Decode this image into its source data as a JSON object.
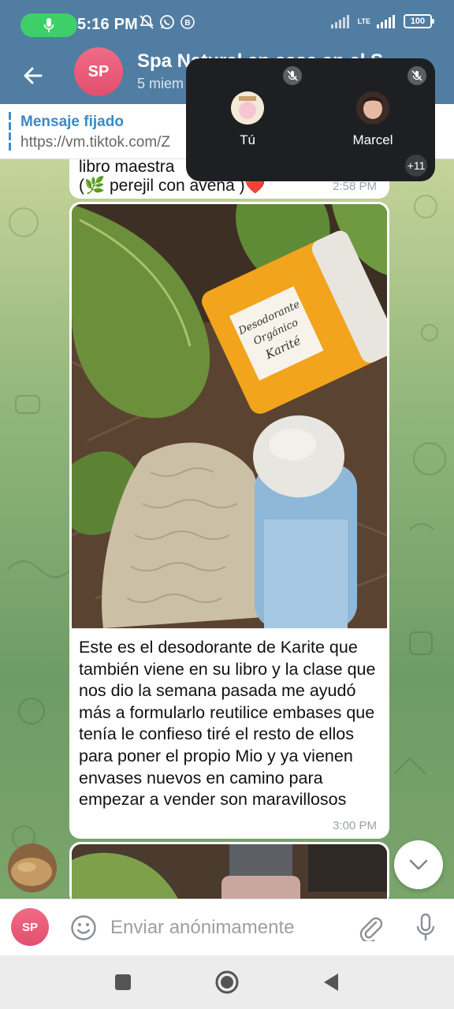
{
  "status_bar": {
    "time": "5:16 PM",
    "network": "LTE",
    "battery": "100",
    "icons": [
      "mic-icon",
      "bell-off-icon",
      "whatsapp-icon",
      "b-badge-icon",
      "signal-icon",
      "battery-icon"
    ]
  },
  "header": {
    "avatar_initials": "SP",
    "title": "Spa Natural en casa en el S",
    "subtitle": "5 miem"
  },
  "pinned": {
    "title": "Mensaje fijado",
    "text": "https://vm.tiktok.com/Z"
  },
  "voice_chat": {
    "participants": [
      {
        "name": "Tú"
      },
      {
        "name": "Marcel"
      }
    ],
    "more_count": "+11"
  },
  "messages": [
    {
      "line1": "libro maestra",
      "line2": "(🌿 perejil con avena )❤️",
      "time": "2:58 PM"
    },
    {
      "caption": "Este es el desodorante de Karite que también viene en su libro y la clase que nos dio la semana pasada me ayudó más a formularlo reutilice embases que tenía le confieso tiré el resto de ellos para poner el propio Mio y ya vienen envases nuevos en camino para empezar a vender son maravillosos",
      "time": "3:00 PM",
      "photo_label": {
        "line1": "Desodorante",
        "line2": "Orgánico",
        "line3": "Karité"
      }
    }
  ],
  "input": {
    "avatar_initials": "SP",
    "placeholder": "Enviar anónimamente"
  },
  "colors": {
    "header": "#517da2",
    "accent": "#3a8ac6",
    "avatar": "#e85a78",
    "mic_pill": "#3ecf68"
  }
}
